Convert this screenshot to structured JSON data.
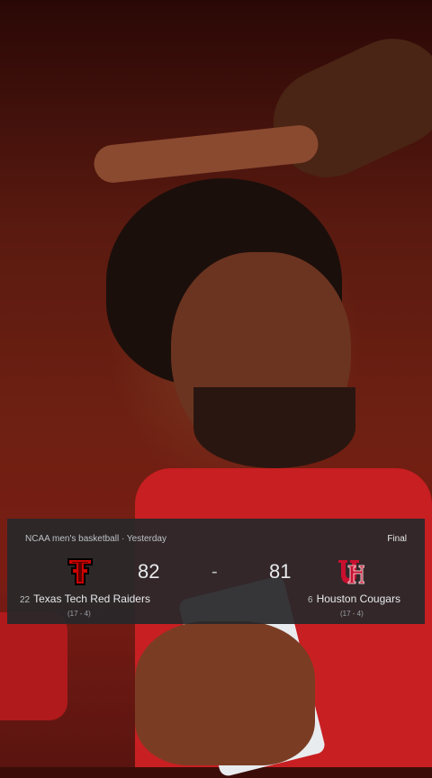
{
  "scorecard": {
    "league": "NCAA men's basketball · Yesterday",
    "status": "Final",
    "separator": "-",
    "home": {
      "rank": "22",
      "name": "Texas Tech Red Raiders",
      "score": "82",
      "record": "(17 - 4)",
      "logo": "texas-tech-logo",
      "color": "#cc0000"
    },
    "away": {
      "rank": "6",
      "name": "Houston Cougars",
      "score": "81",
      "record": "(17 - 4)",
      "logo": "houston-logo",
      "color": "#c8102e"
    }
  }
}
